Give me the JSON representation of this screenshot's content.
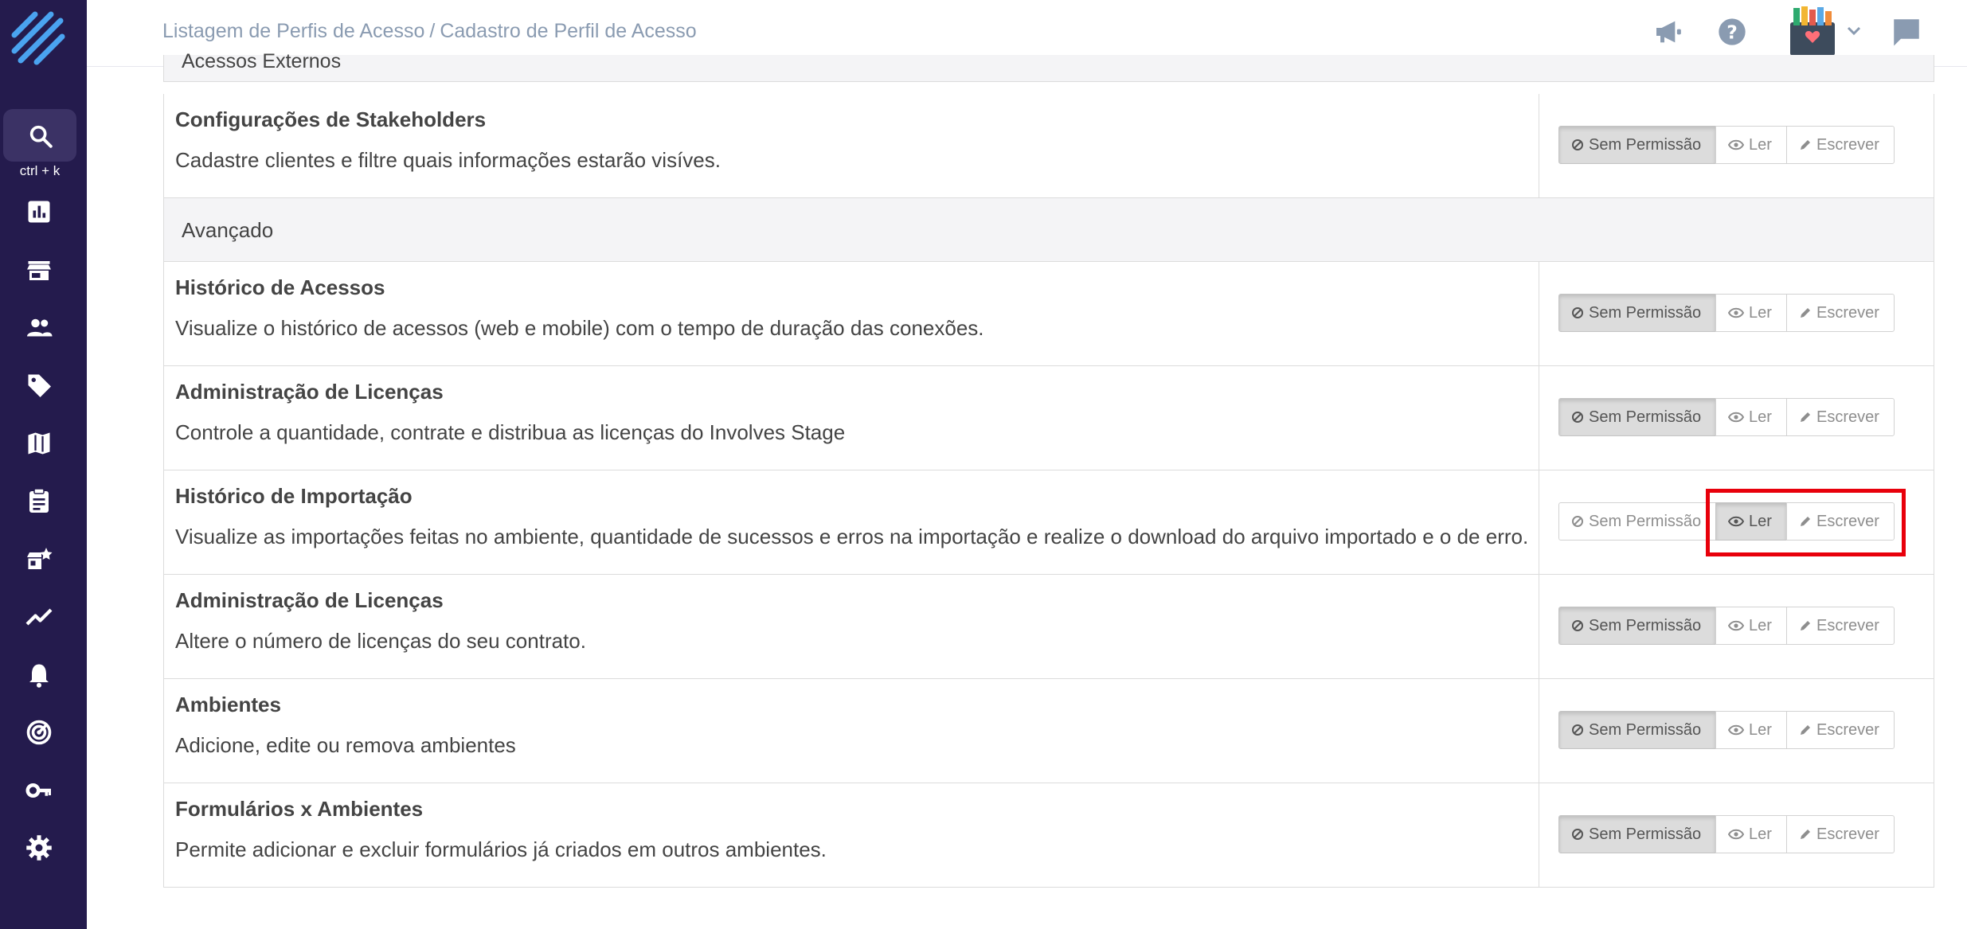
{
  "sidebar": {
    "kbd_hint": "ctrl + k",
    "icons": [
      "logo-icon",
      "search-icon",
      "dashboard-icon",
      "store-icon",
      "people-icon",
      "tag-icon",
      "map-icon",
      "clipboard-icon",
      "featured-store-icon",
      "trend-icon",
      "bell-icon",
      "radar-icon",
      "key-icon",
      "gear-icon"
    ]
  },
  "header": {
    "breadcrumb_1": "Listagem de Perfis de Acesso",
    "breadcrumb_sep": "/",
    "breadcrumb_2": "Cadastro de Perfil de Acesso"
  },
  "colors": {
    "sidebar": "#241b4d",
    "highlight": "#e8000b",
    "text": "#444444",
    "muted": "#8a9bb1"
  },
  "sections": {
    "cut_header": "Acessos Externos",
    "advanced": "Avançado"
  },
  "buttons": {
    "none": "Sem Permissão",
    "read": "Ler",
    "write": "Escrever"
  },
  "rows": [
    {
      "title": "Configurações de Stakeholders",
      "desc": "Cadastre clientes e filtre quais informações estarão visíves.",
      "selected": "none"
    },
    {
      "title": "Histórico de Acessos",
      "desc": "Visualize o histórico de acessos (web e mobile) com o tempo de duração das conexões.",
      "selected": "none"
    },
    {
      "title": "Administração de Licenças",
      "desc": "Controle a quantidade, contrate e distribua as licenças do Involves Stage",
      "selected": "none"
    },
    {
      "title": "Histórico de Importação",
      "desc": "Visualize as importações feitas no ambiente, quantidade de sucessos e erros na importação e realize o download do arquivo importado e o de erro.",
      "selected": "read"
    },
    {
      "title": "Administração de Licenças",
      "desc": "Altere o número de licenças do seu contrato.",
      "selected": "none"
    },
    {
      "title": "Ambientes",
      "desc": "Adicione, edite ou remova ambientes",
      "selected": "none"
    },
    {
      "title": "Formulários x Ambientes",
      "desc": "Permite adicionar e excluir formulários já criados em outros ambientes.",
      "selected": "none"
    }
  ]
}
